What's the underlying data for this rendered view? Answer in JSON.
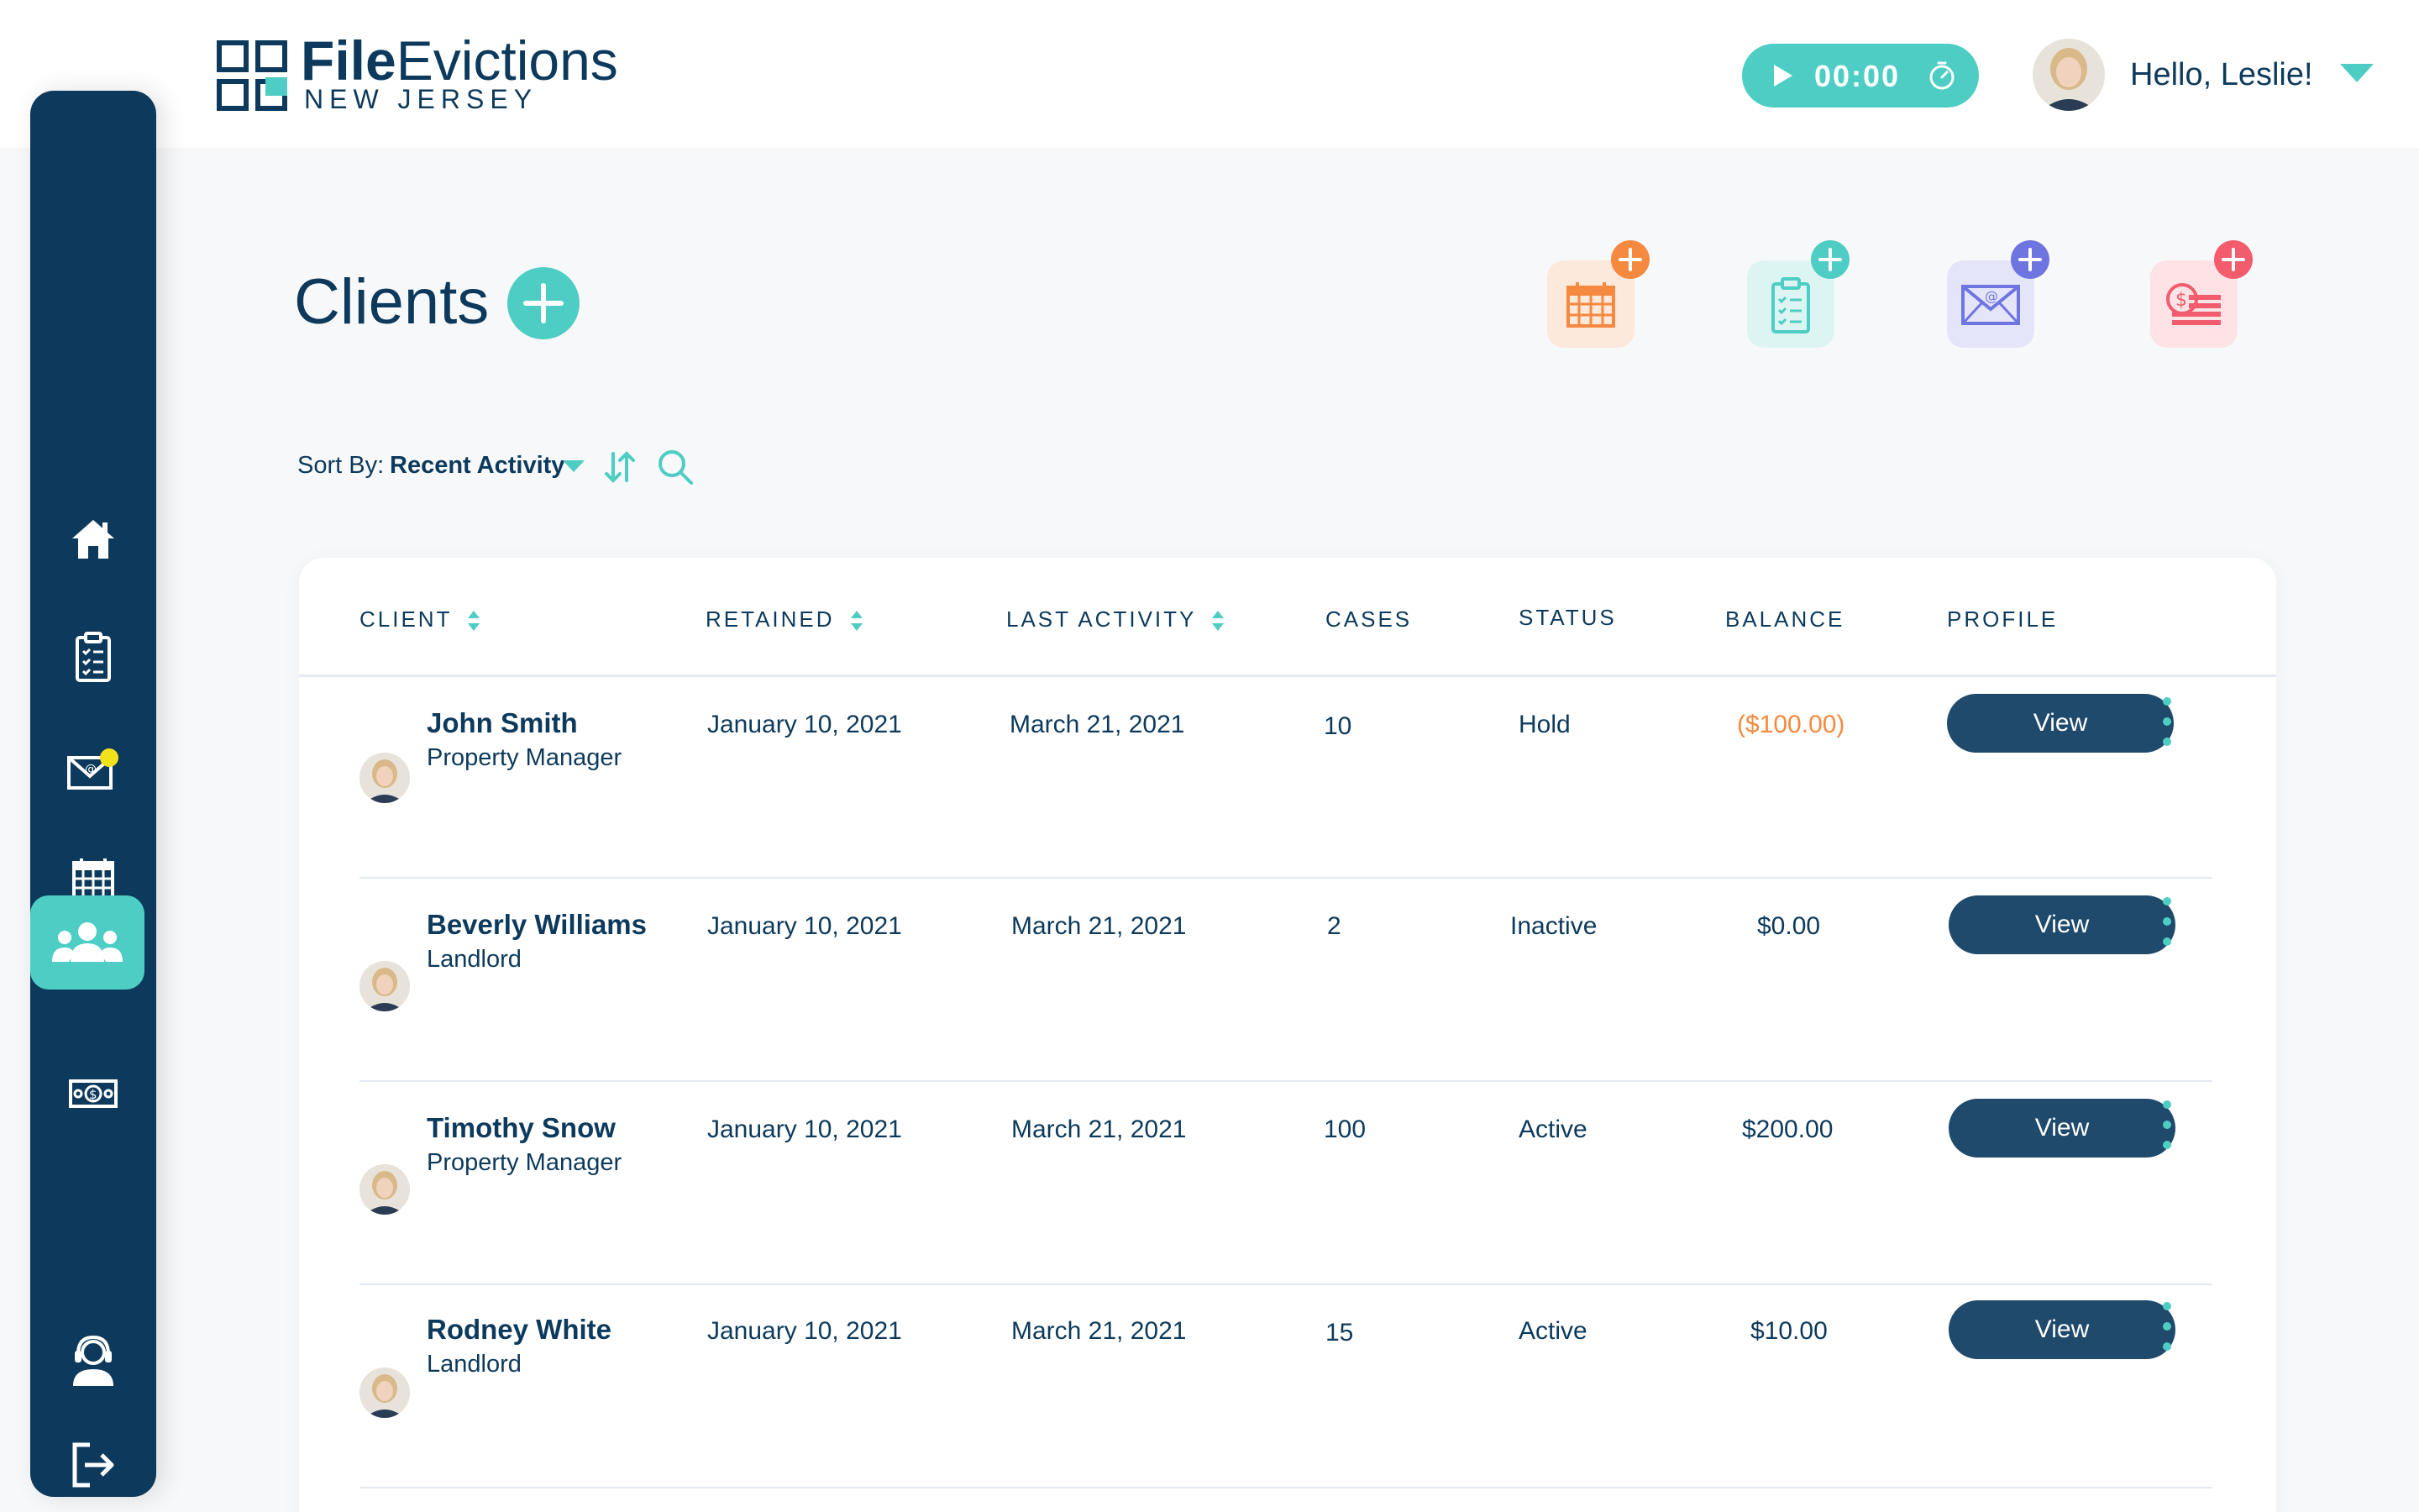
{
  "brand": {
    "title_bold": "File",
    "title_rest": "Evictions",
    "subtitle": "NEW JERSEY"
  },
  "timer": {
    "value": "00:00"
  },
  "user": {
    "greeting": "Hello, Leslie!"
  },
  "sidebar": {
    "items": [
      {
        "name": "home",
        "icon": "home-icon",
        "active": false
      },
      {
        "name": "cases",
        "icon": "clipboard-icon",
        "active": false
      },
      {
        "name": "messages",
        "icon": "mail-icon",
        "active": false,
        "has_notification": true
      },
      {
        "name": "calendar",
        "icon": "calendar-icon",
        "active": false
      },
      {
        "name": "clients",
        "icon": "users-icon",
        "active": true
      },
      {
        "name": "billing",
        "icon": "money-icon",
        "active": false
      },
      {
        "name": "support",
        "icon": "support-agent-icon",
        "active": false
      },
      {
        "name": "logout",
        "icon": "logout-icon",
        "active": false
      }
    ]
  },
  "page": {
    "title": "Clients"
  },
  "quick_actions": [
    {
      "name": "add-event",
      "icon": "calendar-plus-icon",
      "color": "#f5893f",
      "bg": "#fde8dc"
    },
    {
      "name": "add-case",
      "icon": "clipboard-plus-icon",
      "color": "#4ecdc4",
      "bg": "#ddf5f2"
    },
    {
      "name": "add-message",
      "icon": "mail-plus-icon",
      "color": "#6f75e0",
      "bg": "#e4e5f8"
    },
    {
      "name": "add-payment",
      "icon": "payment-plus-icon",
      "color": "#f25c6d",
      "bg": "#fde3e6"
    }
  ],
  "sort": {
    "label": "Sort By:",
    "value": "Recent Activity"
  },
  "table": {
    "headers": {
      "client": "CLIENT",
      "retained": "RETAINED",
      "last_activity": "LAST ACTIVITY",
      "cases": "CASES",
      "status": "STATUS",
      "balance": "BALANCE",
      "profile": "PROFILE"
    },
    "view_label": "View",
    "rows": [
      {
        "name": "John Smith",
        "role": "Property Manager",
        "retained": "January 10, 2021",
        "last_activity": "March 21, 2021",
        "cases": "10",
        "status": "Hold",
        "balance": "($100.00)",
        "balance_negative": true
      },
      {
        "name": "Beverly Williams",
        "role": "Landlord",
        "retained": "January 10, 2021",
        "last_activity": "March 21, 2021",
        "cases": "2",
        "status": "Inactive",
        "balance": "$0.00",
        "balance_negative": false
      },
      {
        "name": "Timothy Snow",
        "role": "Property Manager",
        "retained": "January 10, 2021",
        "last_activity": "March 21, 2021",
        "cases": "100",
        "status": "Active",
        "balance": "$200.00",
        "balance_negative": false
      },
      {
        "name": "Rodney White",
        "role": "Landlord",
        "retained": "January 10, 2021",
        "last_activity": "March 21, 2021",
        "cases": "15",
        "status": "Active",
        "balance": "$10.00",
        "balance_negative": false
      }
    ]
  },
  "colors": {
    "navy": "#0d3a5c",
    "teal": "#4ecdc4",
    "button": "#1f4a6c",
    "negative": "#f5893f"
  }
}
